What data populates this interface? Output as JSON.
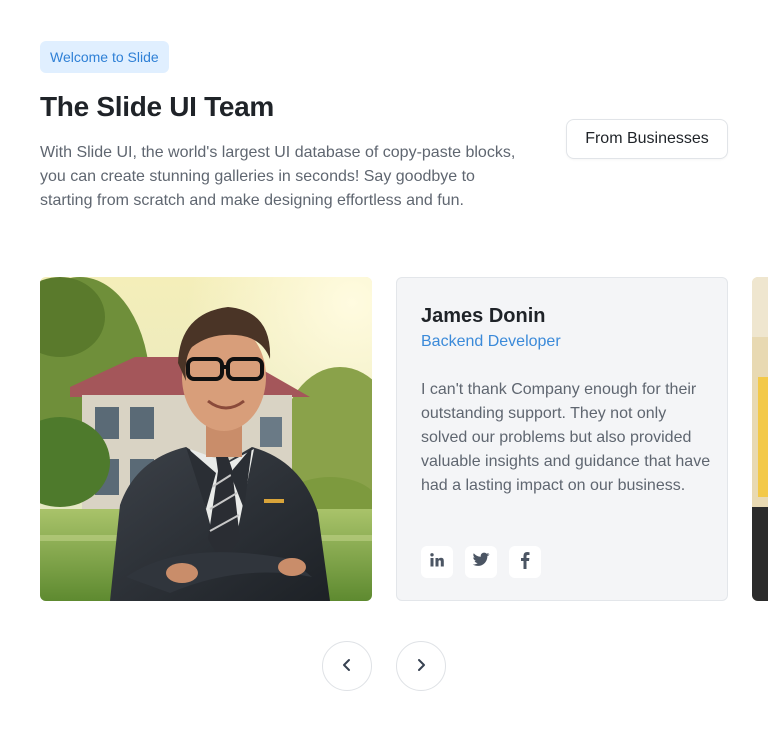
{
  "header": {
    "badge": "Welcome to Slide",
    "title": "The Slide UI Team",
    "description": "With Slide UI, the world's largest UI database of copy-paste blocks, you can create stunning galleries in seconds! Say goodbye to starting from scratch and make designing effortless and fun.",
    "filter_button": "From Businesses"
  },
  "member": {
    "name": "James Donin",
    "role": "Backend Developer",
    "quote": "I can't thank Company enough for their outstanding support. They not only solved our problems but also provided valuable insights and guidance that have had a lasting impact on our business.",
    "socials": [
      {
        "icon": "linkedin-icon"
      },
      {
        "icon": "twitter-icon"
      },
      {
        "icon": "facebook-icon"
      }
    ]
  },
  "carousel": {
    "prev_icon": "chevron-left-icon",
    "next_icon": "chevron-right-icon"
  },
  "colors": {
    "accent": "#3b8ad9",
    "badge_bg": "#e0efff",
    "card_bg": "#f4f5f7"
  }
}
